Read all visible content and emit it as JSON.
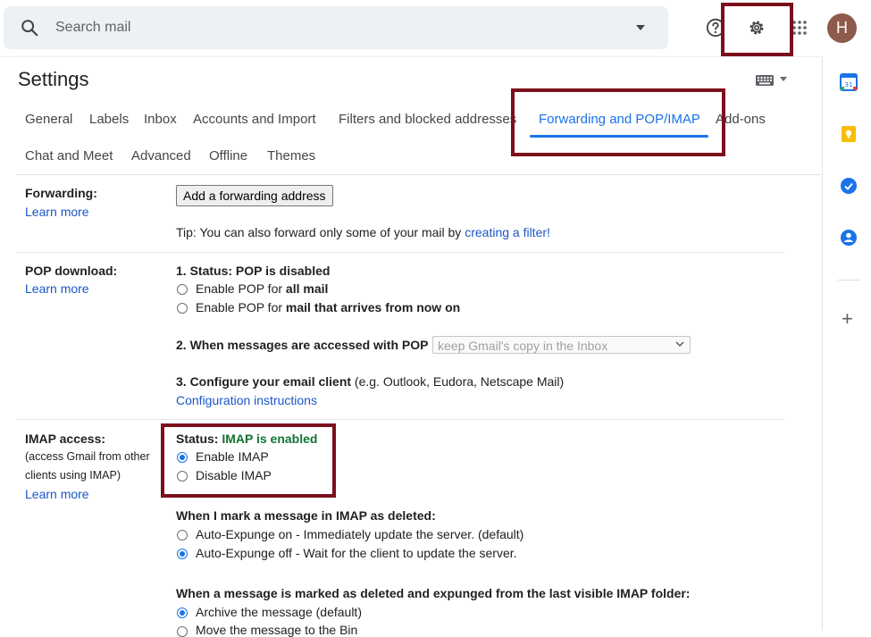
{
  "search": {
    "placeholder": "Search mail"
  },
  "header": {
    "avatar_letter": "H"
  },
  "page": {
    "title": "Settings"
  },
  "tabs": [
    {
      "label": "General"
    },
    {
      "label": "Labels"
    },
    {
      "label": "Inbox"
    },
    {
      "label": "Accounts and Import"
    },
    {
      "label": "Filters and blocked addresses"
    },
    {
      "label": "Forwarding and POP/IMAP",
      "active": true
    },
    {
      "label": "Add-ons"
    },
    {
      "label": "Chat and Meet"
    },
    {
      "label": "Advanced"
    },
    {
      "label": "Offline"
    },
    {
      "label": "Themes"
    }
  ],
  "forwarding": {
    "label": "Forwarding:",
    "learn_more": "Learn more",
    "button": "Add a forwarding address",
    "tip_prefix": "Tip: You can also forward only some of your mail by ",
    "tip_link": "creating a filter!"
  },
  "pop": {
    "label": "POP download:",
    "learn_more": "Learn more",
    "status": "1. Status: POP is disabled",
    "opt1_prefix": "Enable POP for ",
    "opt1_bold": "all mail",
    "opt2_prefix": "Enable POP for ",
    "opt2_bold": "mail that arrives from now on",
    "access_label": "2. When messages are accessed with POP",
    "access_select": "keep Gmail's copy in the Inbox",
    "configure_bold": "3. Configure your email client",
    "configure_rest": " (e.g. Outlook, Eudora, Netscape Mail)",
    "config_link": "Configuration instructions"
  },
  "imap": {
    "label": "IMAP access:",
    "desc_line1": "(access Gmail from other",
    "desc_line2": "clients using IMAP)",
    "learn_more": "Learn more",
    "status_prefix": "Status: ",
    "status_value": "IMAP is enabled",
    "enable": "Enable IMAP",
    "disable": "Disable IMAP",
    "selected": "enable",
    "deleted_heading": "When I mark a message in IMAP as deleted:",
    "expunge_on": "Auto-Expunge on - Immediately update the server. (default)",
    "expunge_off": "Auto-Expunge off - Wait for the client to update the server.",
    "expunge_selected": "off",
    "expunged_heading": "When a message is marked as deleted and expunged from the last visible IMAP folder:",
    "archive": "Archive the message (default)",
    "move_bin": "Move the message to the Bin",
    "expunged_selected": "archive"
  },
  "colors": {
    "accent": "#1a73e8",
    "highlight_box": "#7b0f1c",
    "status_green": "#137333",
    "avatar": "#8d5a4b"
  },
  "icons": [
    "search-icon",
    "help-icon",
    "gear-icon",
    "apps-icon",
    "keyboard-icon",
    "calendar-icon",
    "keep-icon",
    "tasks-icon",
    "contacts-icon",
    "plus-icon"
  ]
}
